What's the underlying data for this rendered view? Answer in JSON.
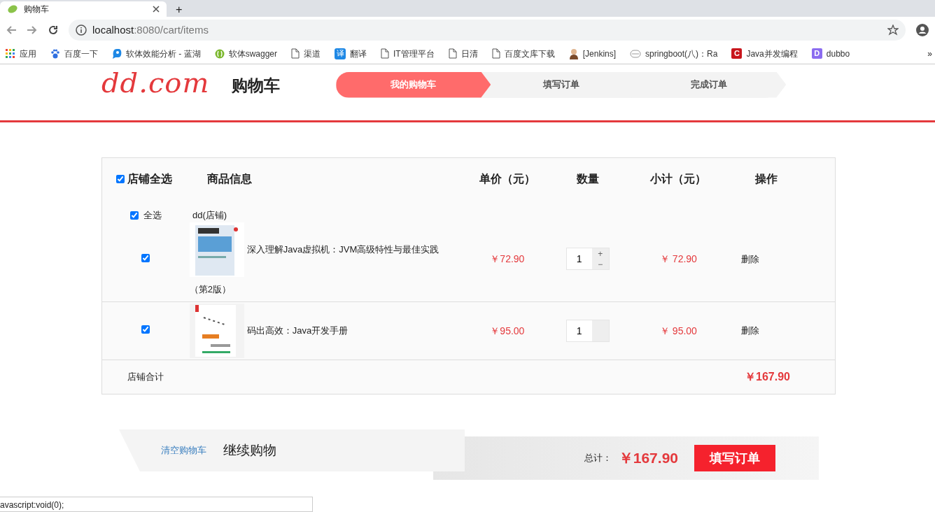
{
  "browser": {
    "tab_title": "购物车",
    "new_tab": "+",
    "url_host": "localhost",
    "url_rest": ":8080/cart/items",
    "bookmarks": [
      {
        "kind": "apps",
        "label": "应用"
      },
      {
        "kind": "paw",
        "label": "百度一下"
      },
      {
        "kind": "bird",
        "label": "软体效能分析 - 蓝湖"
      },
      {
        "kind": "globe",
        "label": "软体swagger"
      },
      {
        "kind": "page",
        "label": "渠道"
      },
      {
        "kind": "translate",
        "label": "翻译",
        "glyph": "译"
      },
      {
        "kind": "page",
        "label": "IT管理平台"
      },
      {
        "kind": "page",
        "label": "日清"
      },
      {
        "kind": "page",
        "label": "百度文库下载"
      },
      {
        "kind": "person",
        "label": "[Jenkins]"
      },
      {
        "kind": "robot",
        "label": "springboot(八)：Ra"
      },
      {
        "kind": "letter",
        "label": "Java并发编程",
        "glyph": "C",
        "color": "#c8161d"
      },
      {
        "kind": "letter",
        "label": "dubbo",
        "glyph": "D",
        "color": "#8b6cf0"
      }
    ],
    "more": "»"
  },
  "header": {
    "logo": "dd.com",
    "title": "购物车",
    "steps": [
      {
        "label": "我的购物车",
        "selected": true
      },
      {
        "label": "填写订单",
        "selected": false
      },
      {
        "label": "完成订单",
        "selected": false
      }
    ]
  },
  "cart": {
    "select_all": {
      "label": "店铺全选",
      "checked": true
    },
    "columns": [
      "商品信息",
      "单价（元）",
      "数量",
      "小计（元）",
      "操作"
    ],
    "shop": {
      "select_all": {
        "label": "全选",
        "checked": true
      },
      "name": "dd(店铺)"
    },
    "items": [
      {
        "checked": true,
        "title_lines": [
          "深入理解Java虚拟机：JVM高级特性与最佳实践",
          "（第2版）"
        ],
        "price": "￥72.90",
        "quantity": "1",
        "plus": "+",
        "minus": "−",
        "subtotal": "￥ 72.90",
        "action": "删除"
      },
      {
        "checked": true,
        "title_lines": [
          "码出高效：Java开发手册"
        ],
        "price": "￥95.00",
        "quantity": "1",
        "subtotal": "￥ 95.00",
        "action": "删除"
      }
    ],
    "shop_total": {
      "label": "店铺合计",
      "amount": "￥167.90"
    }
  },
  "footer": {
    "clear": "清空购物车",
    "continue": "继续购物",
    "total_label": "总计：",
    "total": "￥167.90",
    "submit": "填写订单"
  },
  "status_bar": "avascript:void(0);"
}
